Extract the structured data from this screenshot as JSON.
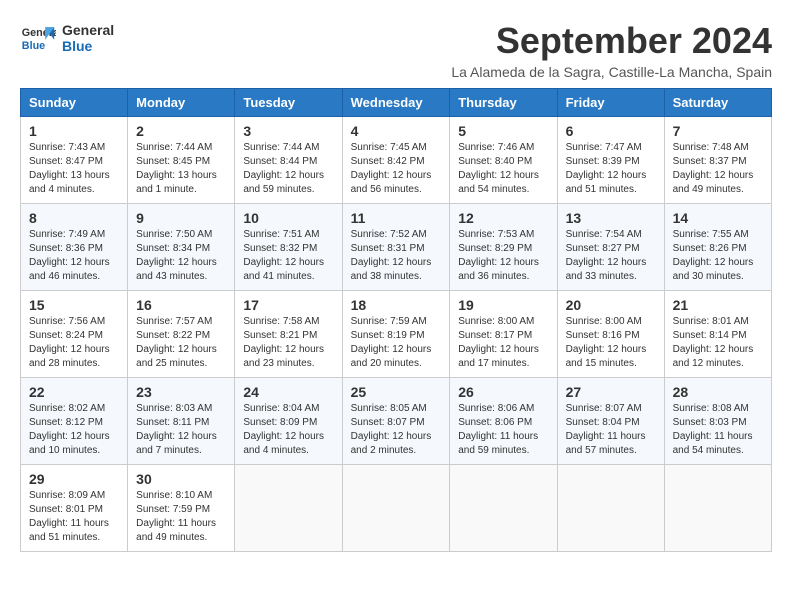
{
  "logo": {
    "text_general": "General",
    "text_blue": "Blue"
  },
  "title": "September 2024",
  "location": "La Alameda de la Sagra, Castille-La Mancha, Spain",
  "weekdays": [
    "Sunday",
    "Monday",
    "Tuesday",
    "Wednesday",
    "Thursday",
    "Friday",
    "Saturday"
  ],
  "weeks": [
    [
      {
        "day": "1",
        "info": "Sunrise: 7:43 AM\nSunset: 8:47 PM\nDaylight: 13 hours\nand 4 minutes."
      },
      {
        "day": "2",
        "info": "Sunrise: 7:44 AM\nSunset: 8:45 PM\nDaylight: 13 hours\nand 1 minute."
      },
      {
        "day": "3",
        "info": "Sunrise: 7:44 AM\nSunset: 8:44 PM\nDaylight: 12 hours\nand 59 minutes."
      },
      {
        "day": "4",
        "info": "Sunrise: 7:45 AM\nSunset: 8:42 PM\nDaylight: 12 hours\nand 56 minutes."
      },
      {
        "day": "5",
        "info": "Sunrise: 7:46 AM\nSunset: 8:40 PM\nDaylight: 12 hours\nand 54 minutes."
      },
      {
        "day": "6",
        "info": "Sunrise: 7:47 AM\nSunset: 8:39 PM\nDaylight: 12 hours\nand 51 minutes."
      },
      {
        "day": "7",
        "info": "Sunrise: 7:48 AM\nSunset: 8:37 PM\nDaylight: 12 hours\nand 49 minutes."
      }
    ],
    [
      {
        "day": "8",
        "info": "Sunrise: 7:49 AM\nSunset: 8:36 PM\nDaylight: 12 hours\nand 46 minutes."
      },
      {
        "day": "9",
        "info": "Sunrise: 7:50 AM\nSunset: 8:34 PM\nDaylight: 12 hours\nand 43 minutes."
      },
      {
        "day": "10",
        "info": "Sunrise: 7:51 AM\nSunset: 8:32 PM\nDaylight: 12 hours\nand 41 minutes."
      },
      {
        "day": "11",
        "info": "Sunrise: 7:52 AM\nSunset: 8:31 PM\nDaylight: 12 hours\nand 38 minutes."
      },
      {
        "day": "12",
        "info": "Sunrise: 7:53 AM\nSunset: 8:29 PM\nDaylight: 12 hours\nand 36 minutes."
      },
      {
        "day": "13",
        "info": "Sunrise: 7:54 AM\nSunset: 8:27 PM\nDaylight: 12 hours\nand 33 minutes."
      },
      {
        "day": "14",
        "info": "Sunrise: 7:55 AM\nSunset: 8:26 PM\nDaylight: 12 hours\nand 30 minutes."
      }
    ],
    [
      {
        "day": "15",
        "info": "Sunrise: 7:56 AM\nSunset: 8:24 PM\nDaylight: 12 hours\nand 28 minutes."
      },
      {
        "day": "16",
        "info": "Sunrise: 7:57 AM\nSunset: 8:22 PM\nDaylight: 12 hours\nand 25 minutes."
      },
      {
        "day": "17",
        "info": "Sunrise: 7:58 AM\nSunset: 8:21 PM\nDaylight: 12 hours\nand 23 minutes."
      },
      {
        "day": "18",
        "info": "Sunrise: 7:59 AM\nSunset: 8:19 PM\nDaylight: 12 hours\nand 20 minutes."
      },
      {
        "day": "19",
        "info": "Sunrise: 8:00 AM\nSunset: 8:17 PM\nDaylight: 12 hours\nand 17 minutes."
      },
      {
        "day": "20",
        "info": "Sunrise: 8:00 AM\nSunset: 8:16 PM\nDaylight: 12 hours\nand 15 minutes."
      },
      {
        "day": "21",
        "info": "Sunrise: 8:01 AM\nSunset: 8:14 PM\nDaylight: 12 hours\nand 12 minutes."
      }
    ],
    [
      {
        "day": "22",
        "info": "Sunrise: 8:02 AM\nSunset: 8:12 PM\nDaylight: 12 hours\nand 10 minutes."
      },
      {
        "day": "23",
        "info": "Sunrise: 8:03 AM\nSunset: 8:11 PM\nDaylight: 12 hours\nand 7 minutes."
      },
      {
        "day": "24",
        "info": "Sunrise: 8:04 AM\nSunset: 8:09 PM\nDaylight: 12 hours\nand 4 minutes."
      },
      {
        "day": "25",
        "info": "Sunrise: 8:05 AM\nSunset: 8:07 PM\nDaylight: 12 hours\nand 2 minutes."
      },
      {
        "day": "26",
        "info": "Sunrise: 8:06 AM\nSunset: 8:06 PM\nDaylight: 11 hours\nand 59 minutes."
      },
      {
        "day": "27",
        "info": "Sunrise: 8:07 AM\nSunset: 8:04 PM\nDaylight: 11 hours\nand 57 minutes."
      },
      {
        "day": "28",
        "info": "Sunrise: 8:08 AM\nSunset: 8:03 PM\nDaylight: 11 hours\nand 54 minutes."
      }
    ],
    [
      {
        "day": "29",
        "info": "Sunrise: 8:09 AM\nSunset: 8:01 PM\nDaylight: 11 hours\nand 51 minutes."
      },
      {
        "day": "30",
        "info": "Sunrise: 8:10 AM\nSunset: 7:59 PM\nDaylight: 11 hours\nand 49 minutes."
      },
      {
        "day": "",
        "info": ""
      },
      {
        "day": "",
        "info": ""
      },
      {
        "day": "",
        "info": ""
      },
      {
        "day": "",
        "info": ""
      },
      {
        "day": "",
        "info": ""
      }
    ]
  ]
}
